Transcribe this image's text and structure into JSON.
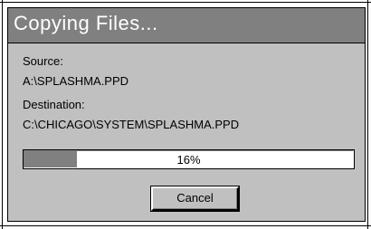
{
  "dialog": {
    "title": "Copying Files...",
    "source_label": "Source:",
    "source_value": "A:\\SPLASHMA.PPD",
    "destination_label": "Destination:",
    "destination_value": "C:\\CHICAGO\\SYSTEM\\SPLASHMA.PPD",
    "progress": {
      "text": "16%",
      "fraction": 0.16
    },
    "cancel_label": "Cancel"
  },
  "colors": {
    "dialog_face": "#c0c0c0",
    "titlebar": "#808080",
    "progress_fill": "#808080",
    "title_text": "#ffffff"
  }
}
